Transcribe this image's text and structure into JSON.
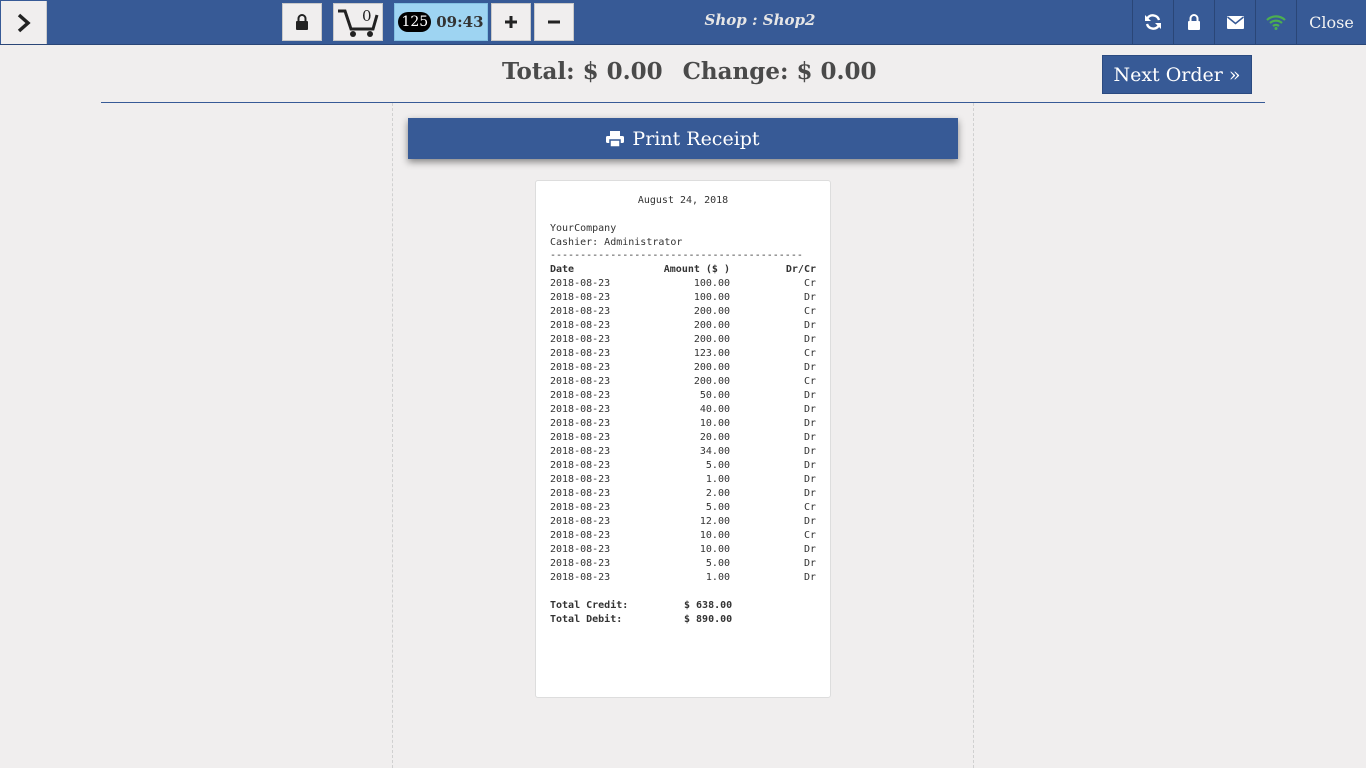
{
  "topbar": {
    "cart_count": "0",
    "time_badge": "125",
    "time": "09:43",
    "shop_title": "Shop : Shop2",
    "close_label": "Close",
    "colors": {
      "bar": "#375a96",
      "wifi": "#4caf50"
    }
  },
  "totals": {
    "total_label": "Total: $ 0.00",
    "change_label": "Change: $ 0.00",
    "next_order_label": "Next Order »"
  },
  "print_button_label": "Print Receipt",
  "receipt": {
    "date": "August 24, 2018",
    "company": "YourCompany",
    "cashier": "Cashier: Administrator",
    "separator": "------------------------------------------",
    "headers": {
      "date": "Date",
      "amount": "Amount ($ )",
      "drcr": "Dr/Cr"
    },
    "rows": [
      {
        "date": "2018-08-23",
        "amount": "100.00",
        "type": "Cr"
      },
      {
        "date": "2018-08-23",
        "amount": "100.00",
        "type": "Dr"
      },
      {
        "date": "2018-08-23",
        "amount": "200.00",
        "type": "Cr"
      },
      {
        "date": "2018-08-23",
        "amount": "200.00",
        "type": "Dr"
      },
      {
        "date": "2018-08-23",
        "amount": "200.00",
        "type": "Dr"
      },
      {
        "date": "2018-08-23",
        "amount": "123.00",
        "type": "Cr"
      },
      {
        "date": "2018-08-23",
        "amount": "200.00",
        "type": "Dr"
      },
      {
        "date": "2018-08-23",
        "amount": "200.00",
        "type": "Cr"
      },
      {
        "date": "2018-08-23",
        "amount": "50.00",
        "type": "Dr"
      },
      {
        "date": "2018-08-23",
        "amount": "40.00",
        "type": "Dr"
      },
      {
        "date": "2018-08-23",
        "amount": "10.00",
        "type": "Dr"
      },
      {
        "date": "2018-08-23",
        "amount": "20.00",
        "type": "Dr"
      },
      {
        "date": "2018-08-23",
        "amount": "34.00",
        "type": "Dr"
      },
      {
        "date": "2018-08-23",
        "amount": "5.00",
        "type": "Dr"
      },
      {
        "date": "2018-08-23",
        "amount": "1.00",
        "type": "Dr"
      },
      {
        "date": "2018-08-23",
        "amount": "2.00",
        "type": "Dr"
      },
      {
        "date": "2018-08-23",
        "amount": "5.00",
        "type": "Cr"
      },
      {
        "date": "2018-08-23",
        "amount": "12.00",
        "type": "Dr"
      },
      {
        "date": "2018-08-23",
        "amount": "10.00",
        "type": "Cr"
      },
      {
        "date": "2018-08-23",
        "amount": "10.00",
        "type": "Dr"
      },
      {
        "date": "2018-08-23",
        "amount": "5.00",
        "type": "Dr"
      },
      {
        "date": "2018-08-23",
        "amount": "1.00",
        "type": "Dr"
      }
    ],
    "total_credit_label": "Total Credit:",
    "total_credit_value": "$ 638.00",
    "total_debit_label": "Total Debit:",
    "total_debit_value": "$ 890.00"
  },
  "icons": {
    "menu_toggle": "chevron-right-icon",
    "lock": "lock-icon",
    "cart": "cart-icon",
    "plus": "plus-icon",
    "minus": "minus-icon",
    "refresh": "refresh-icon",
    "lock_screen": "lock-icon",
    "mail": "mail-icon",
    "wifi": "wifi-icon",
    "print": "printer-icon"
  }
}
